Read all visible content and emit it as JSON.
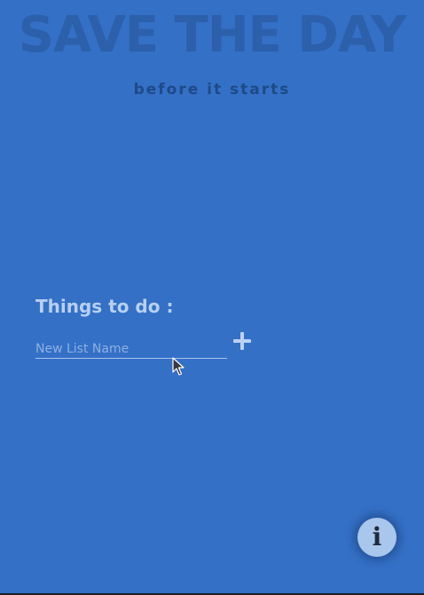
{
  "hero": {
    "title": "SAVE THE DAY",
    "subtitle": "before it starts"
  },
  "todo": {
    "heading": "Things to do :",
    "new_list_placeholder": "New List Name",
    "new_list_value": "",
    "add_icon": "plus-icon"
  },
  "info": {
    "icon": "info-icon",
    "glyph": "i"
  },
  "colors": {
    "background": "#3470c6",
    "title_watermark": "#2c60ab",
    "subtitle": "#1e4a86",
    "heading": "#b7d0f1",
    "info_button": "#a9c6ec"
  }
}
